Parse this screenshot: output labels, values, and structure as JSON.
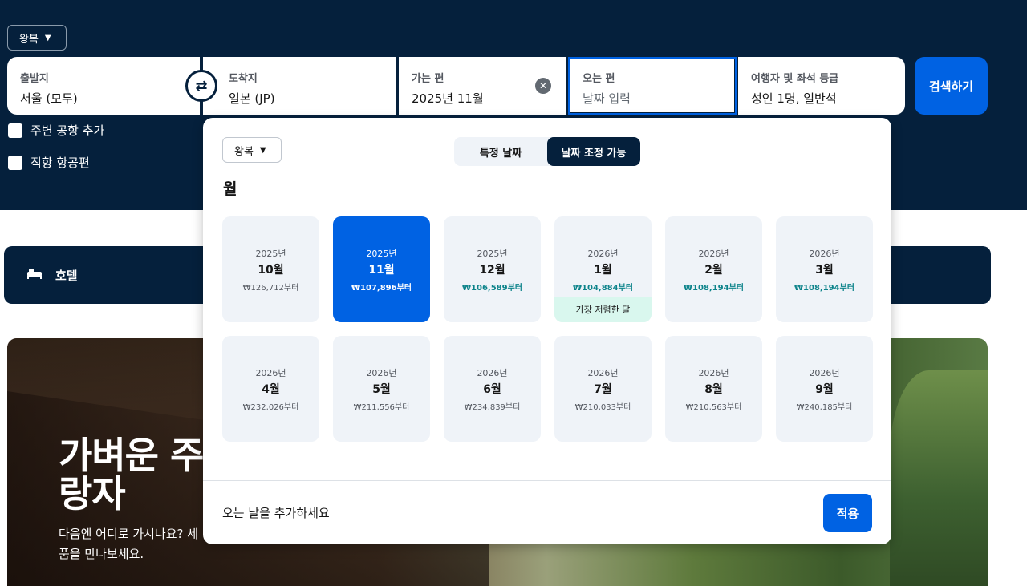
{
  "search": {
    "trip_type": "왕복",
    "origin": {
      "label": "출발지",
      "value": "서울 (모두)"
    },
    "destination": {
      "label": "도착지",
      "value": "일본 (JP)"
    },
    "depart": {
      "label": "가는 편",
      "value": "2025년 11월"
    },
    "return": {
      "label": "오는 편",
      "placeholder": "날짜 입력"
    },
    "travellers": {
      "label": "여행자 및 좌석 등급",
      "value": "성인 1명, 일반석"
    },
    "search_button": "검색하기",
    "nearby_airports": "주변 공항 추가",
    "direct_flights": "직항 항공편"
  },
  "hotel_bar": {
    "label": "호텔"
  },
  "hero": {
    "title_line1": "가벼운 주",
    "title_line2": "랑자",
    "subtitle_line1": "다음엔 어디로 가시나요? 세",
    "subtitle_line2": "품을 만나보세요."
  },
  "date_picker": {
    "trip_type": "왕복",
    "tabs": [
      "특정 날짜",
      "날짜 조정 가능"
    ],
    "active_tab": "날짜 조정 가능",
    "heading": "월",
    "months": [
      {
        "year": "2025년",
        "month": "10월",
        "price": "₩126,712부터"
      },
      {
        "year": "2025년",
        "month": "11월",
        "price": "₩107,896부터"
      },
      {
        "year": "2025년",
        "month": "12월",
        "price": "₩106,589부터"
      },
      {
        "year": "2026년",
        "month": "1월",
        "price": "₩104,884부터",
        "tag": "가장 저렴한 달"
      },
      {
        "year": "2026년",
        "month": "2월",
        "price": "₩108,194부터"
      },
      {
        "year": "2026년",
        "month": "3월",
        "price": "₩108,194부터"
      },
      {
        "year": "2026년",
        "month": "4월",
        "price": "₩232,026부터"
      },
      {
        "year": "2026년",
        "month": "5월",
        "price": "₩211,556부터"
      },
      {
        "year": "2026년",
        "month": "6월",
        "price": "₩234,839부터"
      },
      {
        "year": "2026년",
        "month": "7월",
        "price": "₩210,033부터"
      },
      {
        "year": "2026년",
        "month": "8월",
        "price": "₩210,563부터"
      },
      {
        "year": "2026년",
        "month": "9월",
        "price": "₩240,185부터"
      }
    ],
    "footer_message": "오는 날을 추가하세요",
    "apply_button": "적용"
  },
  "colors": {
    "navy": "#05203c",
    "primary_blue": "#0062e3",
    "price_green": "#0c838a",
    "cheapest_tag_bg": "#d9f7ee"
  },
  "icons": [
    "chevron-down-icon",
    "swap-icon",
    "clear-icon",
    "checkbox-icon",
    "bed-icon"
  ]
}
